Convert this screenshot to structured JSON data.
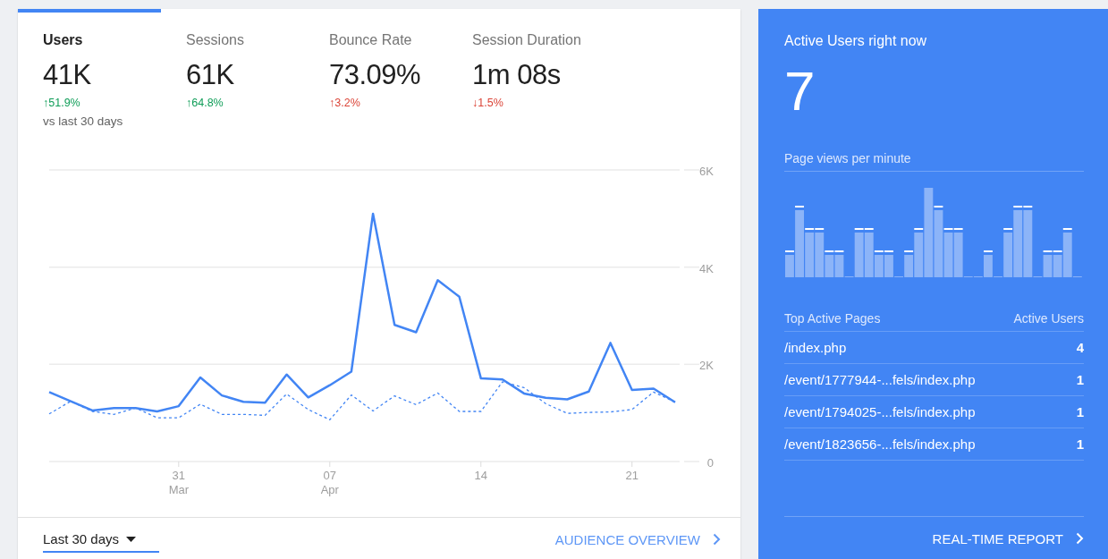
{
  "overview": {
    "metrics": [
      {
        "label": "Users",
        "value": "41K",
        "change": "↑51.9%",
        "color": "#0f9d58",
        "selected": true
      },
      {
        "label": "Sessions",
        "value": "61K",
        "change": "↑64.8%",
        "color": "#0f9d58",
        "selected": false
      },
      {
        "label": "Bounce Rate",
        "value": "73.09%",
        "change": "↑3.2%",
        "color": "#db4437",
        "selected": false
      },
      {
        "label": "Session Duration",
        "value": "1m 08s",
        "change": "↓1.5%",
        "color": "#db4437",
        "selected": false
      }
    ],
    "comparison": "vs last 30 days",
    "chart_data": {
      "type": "line",
      "categories": [
        null,
        null,
        null,
        null,
        null,
        null,
        "31 Mar",
        null,
        null,
        null,
        null,
        null,
        null,
        "07 Apr",
        null,
        null,
        null,
        null,
        null,
        null,
        "14",
        null,
        null,
        null,
        null,
        null,
        null,
        "21",
        null,
        null
      ],
      "series": [
        {
          "color": "#4285f4",
          "line_style": "solid",
          "values": [
            1430,
            1240,
            1050,
            1100,
            1100,
            1030,
            1140,
            1730,
            1360,
            1230,
            1210,
            1790,
            1320,
            1570,
            1850,
            5100,
            2810,
            2660,
            3730,
            3390,
            1710,
            1690,
            1400,
            1310,
            1280,
            1440,
            2440,
            1470,
            1500,
            1220
          ]
        },
        {
          "color": "#4285f4",
          "line_style": "dashed",
          "values": [
            980,
            1240,
            1030,
            970,
            1100,
            900,
            900,
            1180,
            970,
            970,
            950,
            1390,
            1070,
            860,
            1370,
            1040,
            1350,
            1170,
            1410,
            1030,
            1030,
            1640,
            1520,
            1190,
            990,
            1010,
            1020,
            1070,
            1430,
            1220
          ]
        }
      ],
      "ylim": [
        0,
        6000
      ],
      "yticks": [
        {
          "value": 0,
          "label": "0"
        },
        {
          "value": 2000,
          "label": "2K"
        },
        {
          "value": 4000,
          "label": "4K"
        },
        {
          "value": 6000,
          "label": "6K"
        }
      ]
    },
    "date_range": "Last 30 days",
    "link": "AUDIENCE OVERVIEW"
  },
  "realtime": {
    "title": "Active Users right now",
    "count": "7",
    "chart_title": "Page views per minute",
    "table": {
      "columns": [
        "Top Active Pages",
        "Active Users"
      ],
      "rows": [
        [
          "/index.php",
          "4"
        ],
        [
          "/event/1777944-...fels/index.php",
          "1"
        ],
        [
          "/event/1794025-...fels/index.php",
          "1"
        ],
        [
          "/event/1823656-...fels/index.php",
          "1"
        ]
      ]
    },
    "link": "REAL-TIME REPORT"
  }
}
